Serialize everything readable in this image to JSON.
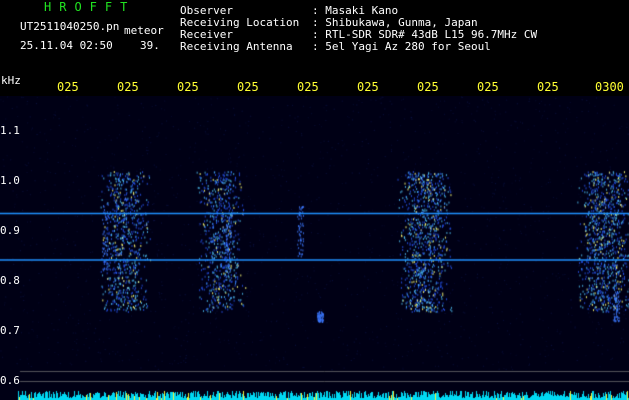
{
  "header": {
    "app_title": "HROFFT",
    "file_name": "UT2511040250.pn",
    "meteor_label": "meteor",
    "timestamp": "25.11.04 02:50",
    "count": "39."
  },
  "info": [
    {
      "label": "Observer",
      "value": ": Masaki Kano"
    },
    {
      "label": "Receiving Location",
      "value": ": Shibukawa, Gunma, Japan"
    },
    {
      "label": "Receiver",
      "value": ": RTL-SDR SDR# 43dB L15 96.7MHz CW"
    },
    {
      "label": "Receiving Antenna",
      "value": ": 5el Yagi Az 280 for Seoul"
    }
  ],
  "chart_data": {
    "type": "heatmap",
    "y_unit": "kHz",
    "y_ticks": [
      "1.1",
      "1.0",
      "0.9",
      "0.8",
      "0.7",
      "0.6"
    ],
    "x_ticks": [
      "025",
      "025",
      "025",
      "025",
      "025",
      "025",
      "025",
      "025",
      "025",
      "0300"
    ],
    "ylim": [
      0.58,
      1.15
    ],
    "carrier_lines_khz": [
      0.935,
      0.842
    ],
    "meteor_echo_bands": [
      {
        "x_center_tick": 1.0,
        "strength": 0.8
      },
      {
        "x_center_tick": 2.6,
        "strength": 0.7
      },
      {
        "x_center_tick": 6.0,
        "strength": 1.0
      },
      {
        "x_center_tick": 9.0,
        "strength": 1.0
      }
    ],
    "colors": {
      "background": "#000015",
      "carrier": "#1e90ff",
      "echo_low": "#1e3cff",
      "echo_high": "#ffff40",
      "baseline": "#00e5ff",
      "noise_band": "#2a2aa0"
    }
  }
}
